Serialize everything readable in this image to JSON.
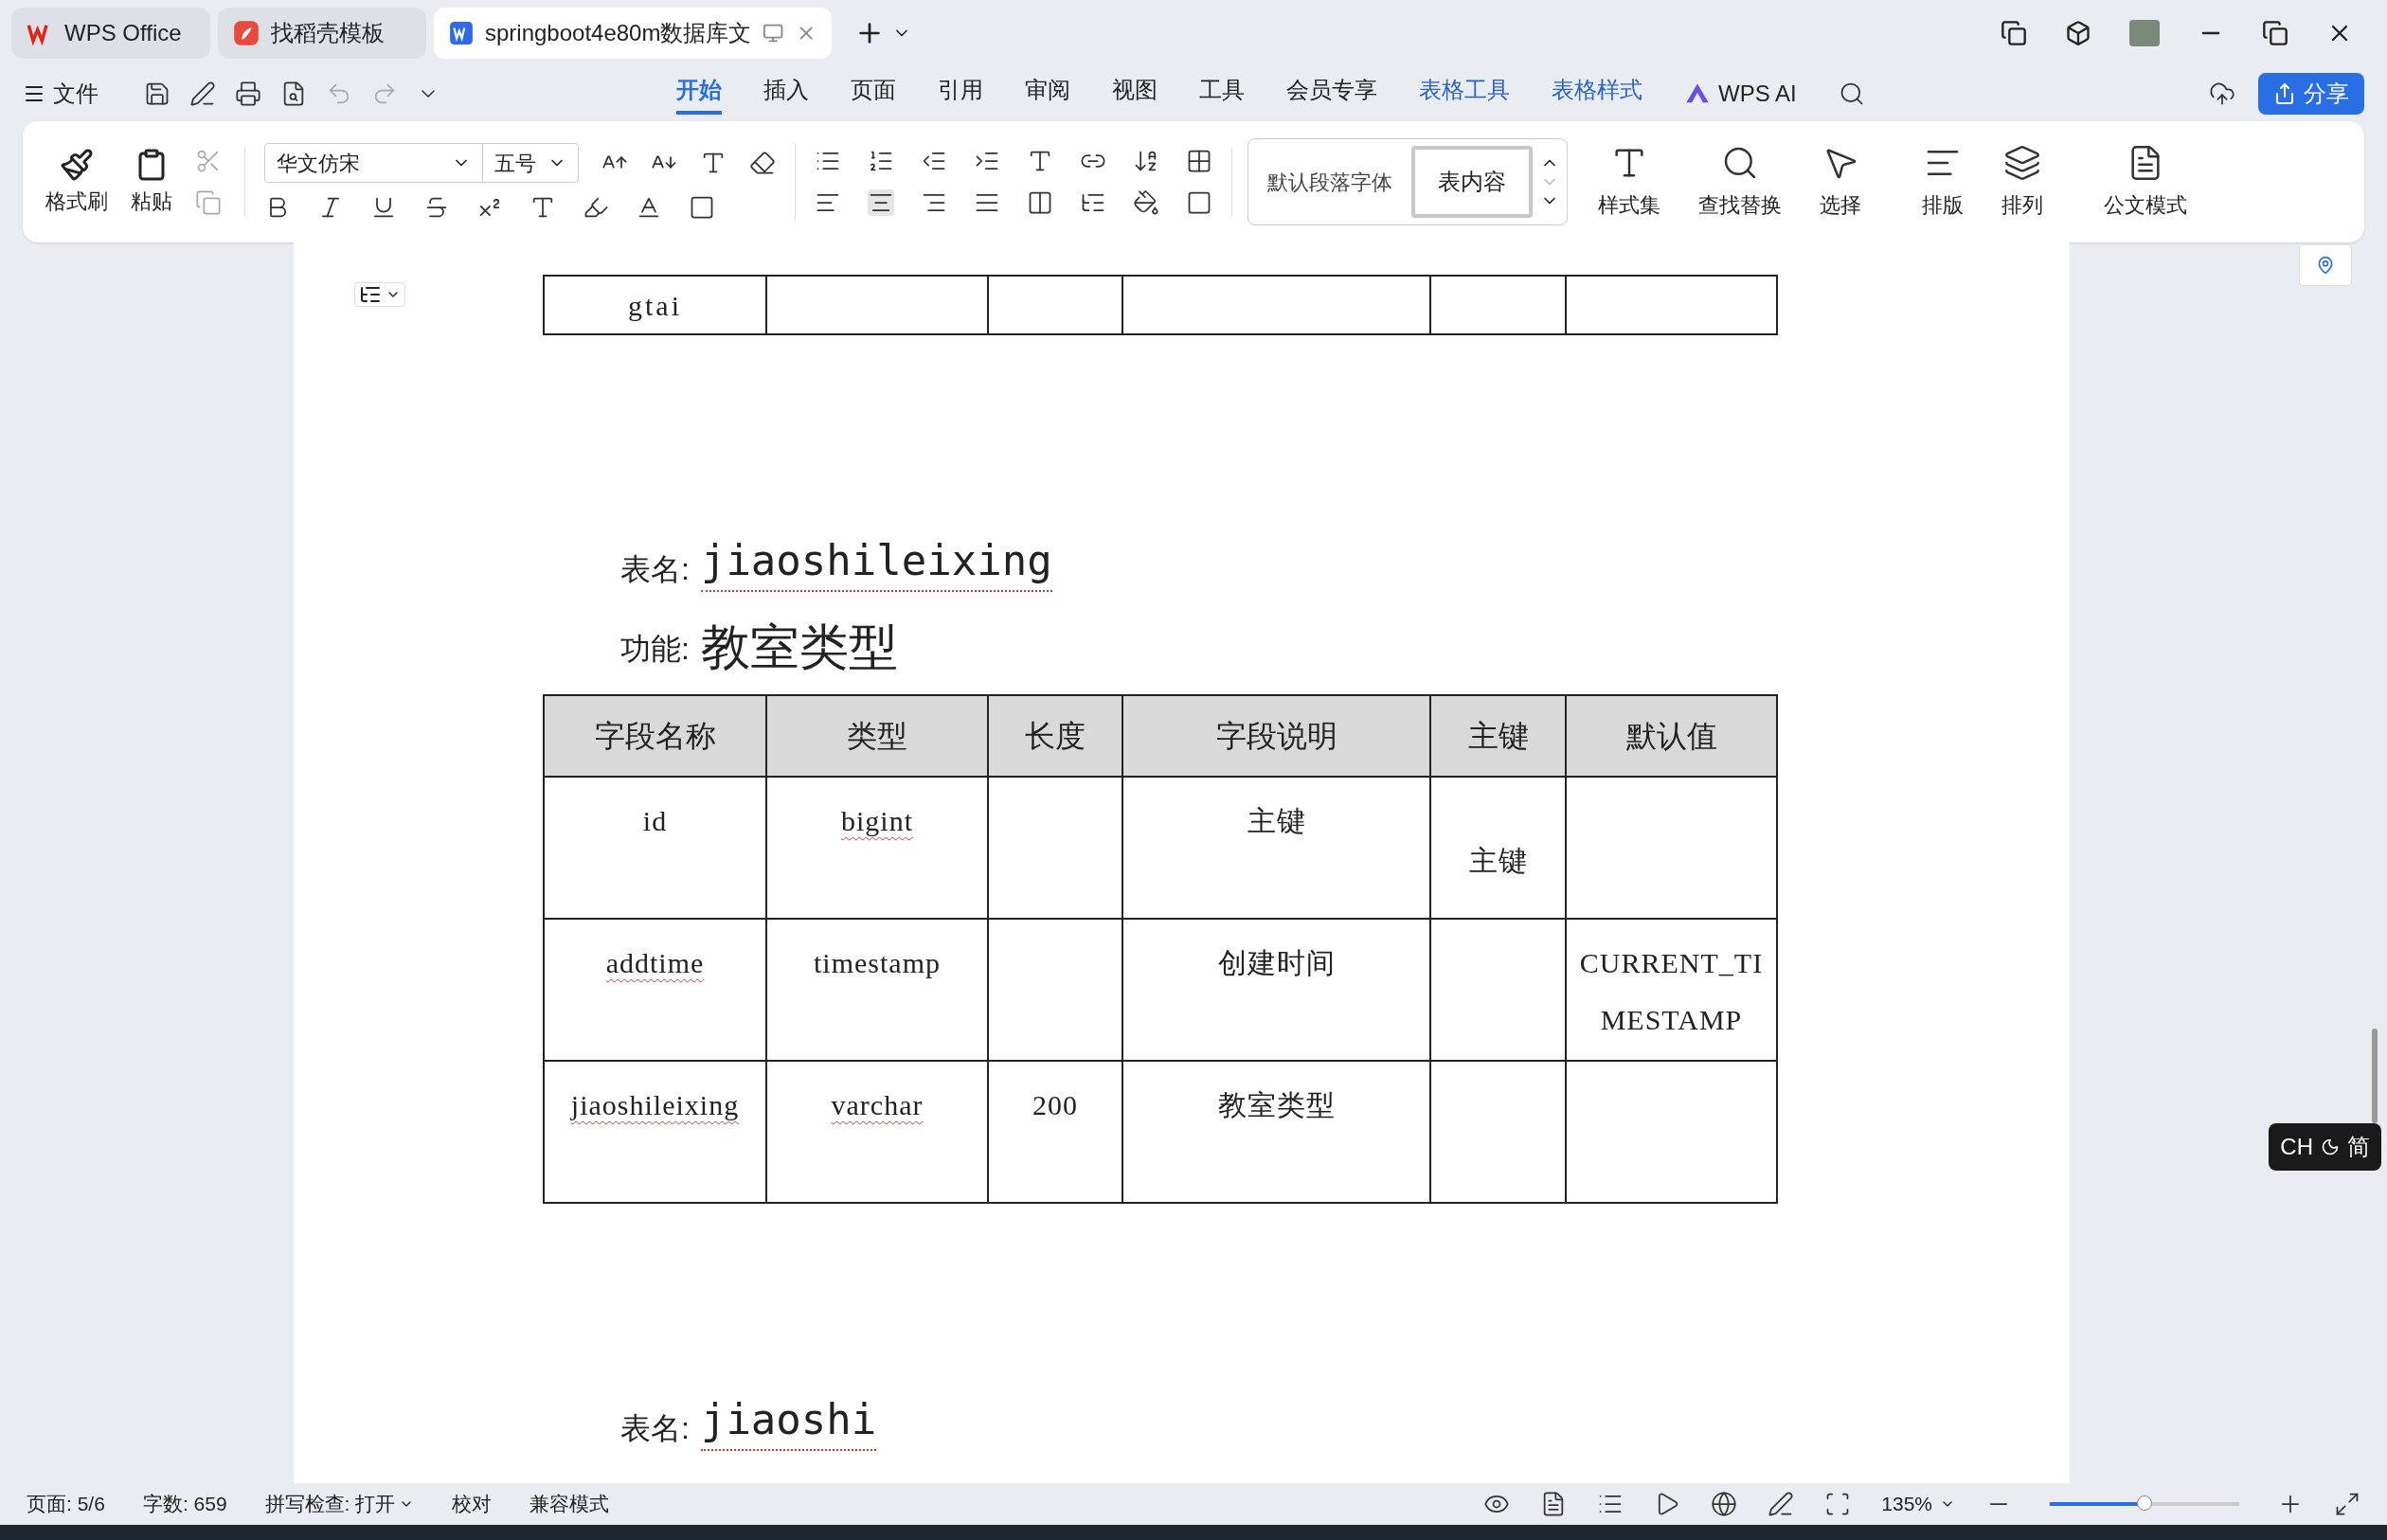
{
  "tabs": [
    {
      "label": "WPS Office",
      "kind": "home",
      "selected": false
    },
    {
      "label": "找稻壳模板",
      "kind": "template",
      "selected": false
    },
    {
      "label": "springboot4e80m数据库文",
      "kind": "document",
      "selected": true
    }
  ],
  "menu": {
    "file": "文件"
  },
  "ribbon_tabs": [
    {
      "label": "开始",
      "kind": "normal",
      "selected": true
    },
    {
      "label": "插入",
      "kind": "normal",
      "selected": false
    },
    {
      "label": "页面",
      "kind": "normal",
      "selected": false
    },
    {
      "label": "引用",
      "kind": "normal",
      "selected": false
    },
    {
      "label": "审阅",
      "kind": "normal",
      "selected": false
    },
    {
      "label": "视图",
      "kind": "normal",
      "selected": false
    },
    {
      "label": "工具",
      "kind": "normal",
      "selected": false
    },
    {
      "label": "会员专享",
      "kind": "normal",
      "selected": false
    },
    {
      "label": "表格工具",
      "kind": "context",
      "selected": false
    },
    {
      "label": "表格样式",
      "kind": "context",
      "selected": false
    }
  ],
  "ai": "WPS AI",
  "share": "分享",
  "ribbon": {
    "format_painter": "格式刷",
    "paste": "粘贴",
    "font": "华文仿宋",
    "font_size": "五号",
    "styles": [
      {
        "label": "默认段落字体",
        "selected": false
      },
      {
        "label": "表内容",
        "selected": true
      }
    ],
    "large_buttons": [
      {
        "label": "样式集",
        "kind": "styles"
      },
      {
        "label": "查找替换",
        "kind": "find"
      },
      {
        "label": "选择",
        "kind": "select"
      },
      {
        "label": "排版",
        "kind": "layout"
      },
      {
        "label": "排列",
        "kind": "arrange"
      },
      {
        "label": "公文模式",
        "kind": "official"
      }
    ]
  },
  "document": {
    "previous_table": {
      "rows": [
        [
          {
            "text": "gtai"
          },
          {},
          {},
          {},
          {},
          {}
        ]
      ]
    },
    "sections": [
      {
        "name_label": "表名:",
        "name": "jiaoshileixing",
        "name_misspelled": true,
        "function_label": "功能:",
        "function": "教室类型",
        "columns": [
          "字段名称",
          "类型",
          "长度",
          "字段说明",
          "主键",
          "默认值"
        ],
        "rows": [
          [
            {
              "text": "id",
              "misspelled": false
            },
            {
              "text": "bigint",
              "misspelled": true
            },
            {},
            {
              "text": "主键",
              "misspelled": false
            },
            {
              "text": "主键",
              "misspelled": false
            },
            {}
          ],
          [
            {
              "text": "addtime",
              "misspelled": true
            },
            {
              "text": "timestamp",
              "misspelled": false
            },
            {},
            {
              "text": "创建时间",
              "misspelled": false
            },
            {},
            {
              "text": "CURRENT_TIMESTAMP",
              "misspelled": false
            }
          ],
          [
            {
              "text": "jiaoshileixing",
              "misspelled": true
            },
            {
              "text": "varchar",
              "misspelled": true
            },
            {
              "text": "200",
              "misspelled": false
            },
            {
              "text": "教室类型",
              "misspelled": false
            },
            {},
            {}
          ]
        ]
      },
      {
        "name_label": "表名:",
        "name": "jiaoshi",
        "name_misspelled": true
      }
    ]
  },
  "ime": {
    "lang": "CH",
    "mode": "简"
  },
  "status_bar": {
    "page": "页面: 5/6",
    "words": "字数: 659",
    "spellcheck": "拼写检查: 打开",
    "proofread": "校对",
    "compat": "兼容模式",
    "zoom": "135%",
    "zoom_slider": {
      "level": 0.5
    }
  }
}
